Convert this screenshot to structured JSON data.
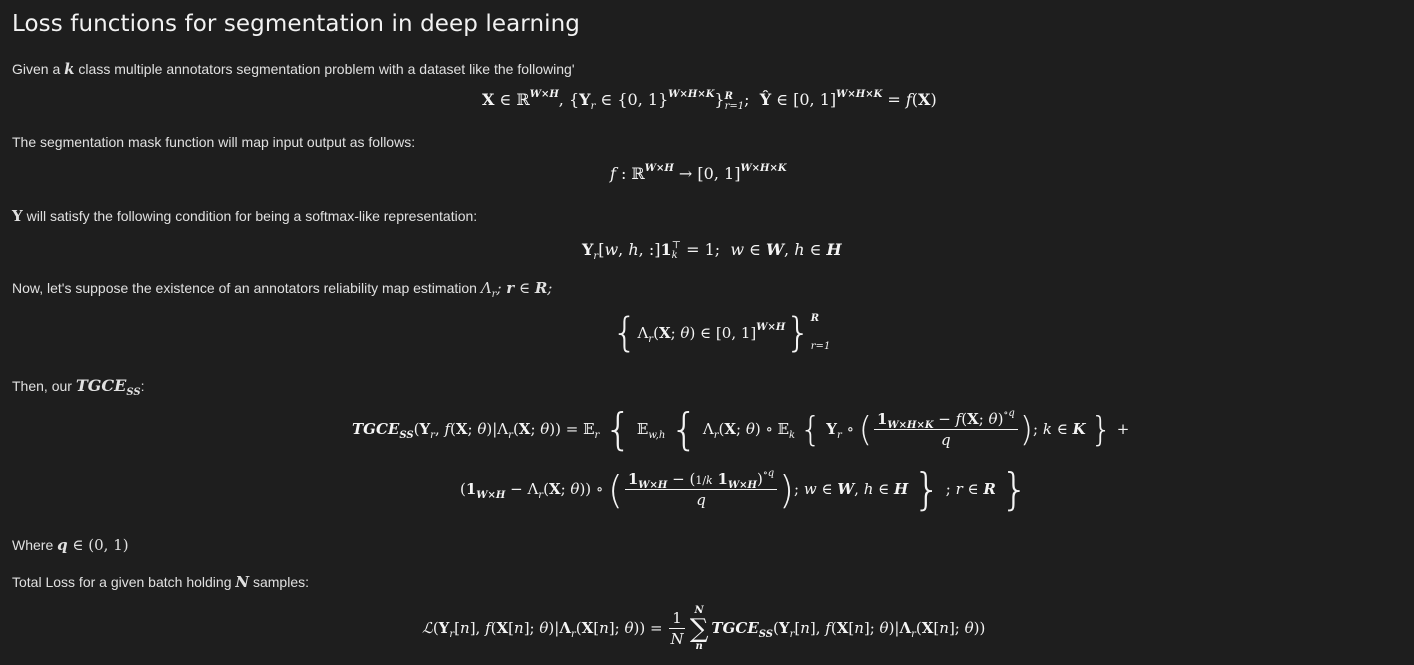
{
  "document": {
    "title": "Loss functions for segmentation in deep learning",
    "para1_before": "Given a ",
    "para1_var": "k",
    "para1_after": " class multiple annotators segmentation problem with a dataset like the following'",
    "para2": "The segmentation mask function will map input output as follows:",
    "para3_var": "Y",
    "para3_after": " will satisfy the following condition for being a softmax-like representation:",
    "para4_before": "Now, let's suppose the existence of an annotators reliability map estimation ",
    "para4_math": "Λr; r ∈ R;",
    "para5_before": "Then, our ",
    "para5_math": "TGCESS",
    "para5_after": ":",
    "para6_before": "Where ",
    "para6_math": "q ∈ (0, 1)",
    "para7_before": "Total Loss for a given batch holding ",
    "para7_var": "N",
    "para7_after": " samples:"
  },
  "equations": {
    "dataset": "X ∈ ℝ^{W×H}, {Y_r ∈ {0,1}^{W×H×K}}_{r=1}^{R}; Ŷ ∈ [0,1]^{W×H×K} = f(X)",
    "mapping": "f : ℝ^{W×H} → [0,1]^{W×H×K}",
    "softmax_condition": "Y_r[w,h,:]1_k^T = 1; w ∈ W, h ∈ H",
    "reliability_set": "{Λ_r(X;θ) ∈ [0,1]^{W×H}}_{r=1}^{R}",
    "tgce_line1": "TGCE_SS(Y_r, f(X;θ)|Λ_r(X;θ)) = E_r{E_{w,h}{Λ_r(X;θ) ∘ E_k{Y_r ∘ ((1_{W×H×K} − f(X;θ)^{∘q})/q); k ∈ K} +",
    "tgce_line2": "(1_{W×H} − Λ_r(X;θ)) ∘ ((1_{W×H} − (1/k 1_{W×H})^{∘q})/q); w ∈ W, h ∈ H}; r ∈ R}",
    "q_range": "q ∈ (0, 1)",
    "total_loss": "ℒ(Y_r[n], f(X[n];θ)|Λ_r(X[n];θ)) = 1/N Σ_n^N TGCE_SS(Y_r[n], f(X[n];θ)|Λ_r(X[n];θ))"
  }
}
